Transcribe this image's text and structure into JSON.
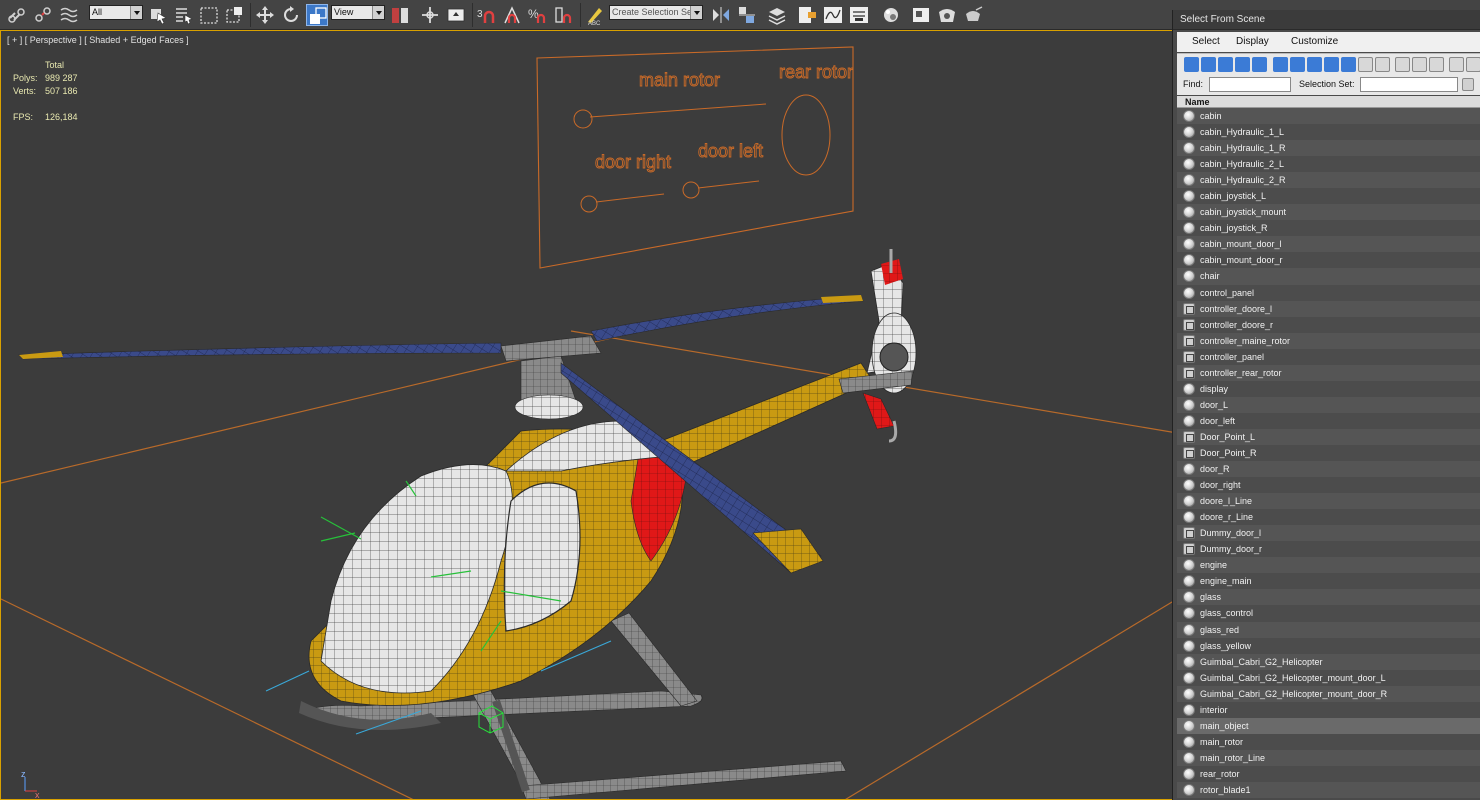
{
  "toolbar": {
    "selection_filter": "All",
    "reference_coord": "View",
    "named_selection_placeholder": "Create Selection Se"
  },
  "viewport": {
    "label": "[ + ] [ Perspective ] [ Shaded + Edged Faces ]",
    "stats": {
      "total_label": "Total",
      "polys_label": "Polys:",
      "polys_value": "989 287",
      "verts_label": "Verts:",
      "verts_value": "507 186",
      "fps_label": "FPS:",
      "fps_value": "126,184"
    },
    "control_panel": {
      "main_rotor": "main rotor",
      "rear_rotor": "rear rotor",
      "door_right": "door right",
      "door_left": "door left"
    },
    "axis": {
      "z": "z",
      "x": "x"
    }
  },
  "explorer": {
    "title": "Select From Scene",
    "menu": {
      "select": "Select",
      "display": "Display",
      "customize": "Customize"
    },
    "find_label": "Find:",
    "selection_set_label": "Selection Set:",
    "column_name": "Name",
    "selected_item": "main_object",
    "items": [
      {
        "name": "cabin",
        "kind": "geometry"
      },
      {
        "name": "cabin_Hydraulic_1_L",
        "kind": "geometry"
      },
      {
        "name": "cabin_Hydraulic_1_R",
        "kind": "geometry"
      },
      {
        "name": "cabin_Hydraulic_2_L",
        "kind": "geometry"
      },
      {
        "name": "cabin_Hydraulic_2_R",
        "kind": "geometry"
      },
      {
        "name": "cabin_joystick_L",
        "kind": "geometry"
      },
      {
        "name": "cabin_joystick_mount",
        "kind": "geometry"
      },
      {
        "name": "cabin_joystick_R",
        "kind": "geometry"
      },
      {
        "name": "cabin_mount_door_l",
        "kind": "geometry"
      },
      {
        "name": "cabin_mount_door_r",
        "kind": "geometry"
      },
      {
        "name": "chair",
        "kind": "geometry"
      },
      {
        "name": "control_panel",
        "kind": "geometry"
      },
      {
        "name": "controller_doore_l",
        "kind": "helper"
      },
      {
        "name": "controller_doore_r",
        "kind": "helper"
      },
      {
        "name": "controller_maine_rotor",
        "kind": "helper"
      },
      {
        "name": "controller_panel",
        "kind": "helper"
      },
      {
        "name": "controller_rear_rotor",
        "kind": "helper"
      },
      {
        "name": "display",
        "kind": "geometry"
      },
      {
        "name": "door_L",
        "kind": "geometry"
      },
      {
        "name": "door_left",
        "kind": "geometry"
      },
      {
        "name": "Door_Point_L",
        "kind": "helper"
      },
      {
        "name": "Door_Point_R",
        "kind": "helper"
      },
      {
        "name": "door_R",
        "kind": "geometry"
      },
      {
        "name": "door_right",
        "kind": "geometry"
      },
      {
        "name": "doore_l_Line",
        "kind": "geometry"
      },
      {
        "name": "doore_r_Line",
        "kind": "geometry"
      },
      {
        "name": "Dummy_door_l",
        "kind": "helper"
      },
      {
        "name": "Dummy_door_r",
        "kind": "helper"
      },
      {
        "name": "engine",
        "kind": "geometry"
      },
      {
        "name": "engine_main",
        "kind": "geometry"
      },
      {
        "name": "glass",
        "kind": "geometry"
      },
      {
        "name": "glass_control",
        "kind": "geometry"
      },
      {
        "name": "glass_red",
        "kind": "geometry"
      },
      {
        "name": "glass_yellow",
        "kind": "geometry"
      },
      {
        "name": "Guimbal_Cabri_G2_Helicopter",
        "kind": "geometry"
      },
      {
        "name": "Guimbal_Cabri_G2_Helicopter_mount_door_L",
        "kind": "geometry"
      },
      {
        "name": "Guimbal_Cabri_G2_Helicopter_mount_door_R",
        "kind": "geometry"
      },
      {
        "name": "interior",
        "kind": "geometry"
      },
      {
        "name": "main_object",
        "kind": "geometry"
      },
      {
        "name": "main_rotor",
        "kind": "geometry"
      },
      {
        "name": "main_rotor_Line",
        "kind": "geometry"
      },
      {
        "name": "rear_rotor",
        "kind": "geometry"
      },
      {
        "name": "rotor_blade1",
        "kind": "geometry"
      }
    ]
  },
  "colors": {
    "viewport_border": "#d9a100",
    "panel_orange": "#c96a28",
    "helicopter_yellow": "#c99a12",
    "helicopter_red": "#e01818",
    "blade_blue": "#3a4a8a"
  }
}
